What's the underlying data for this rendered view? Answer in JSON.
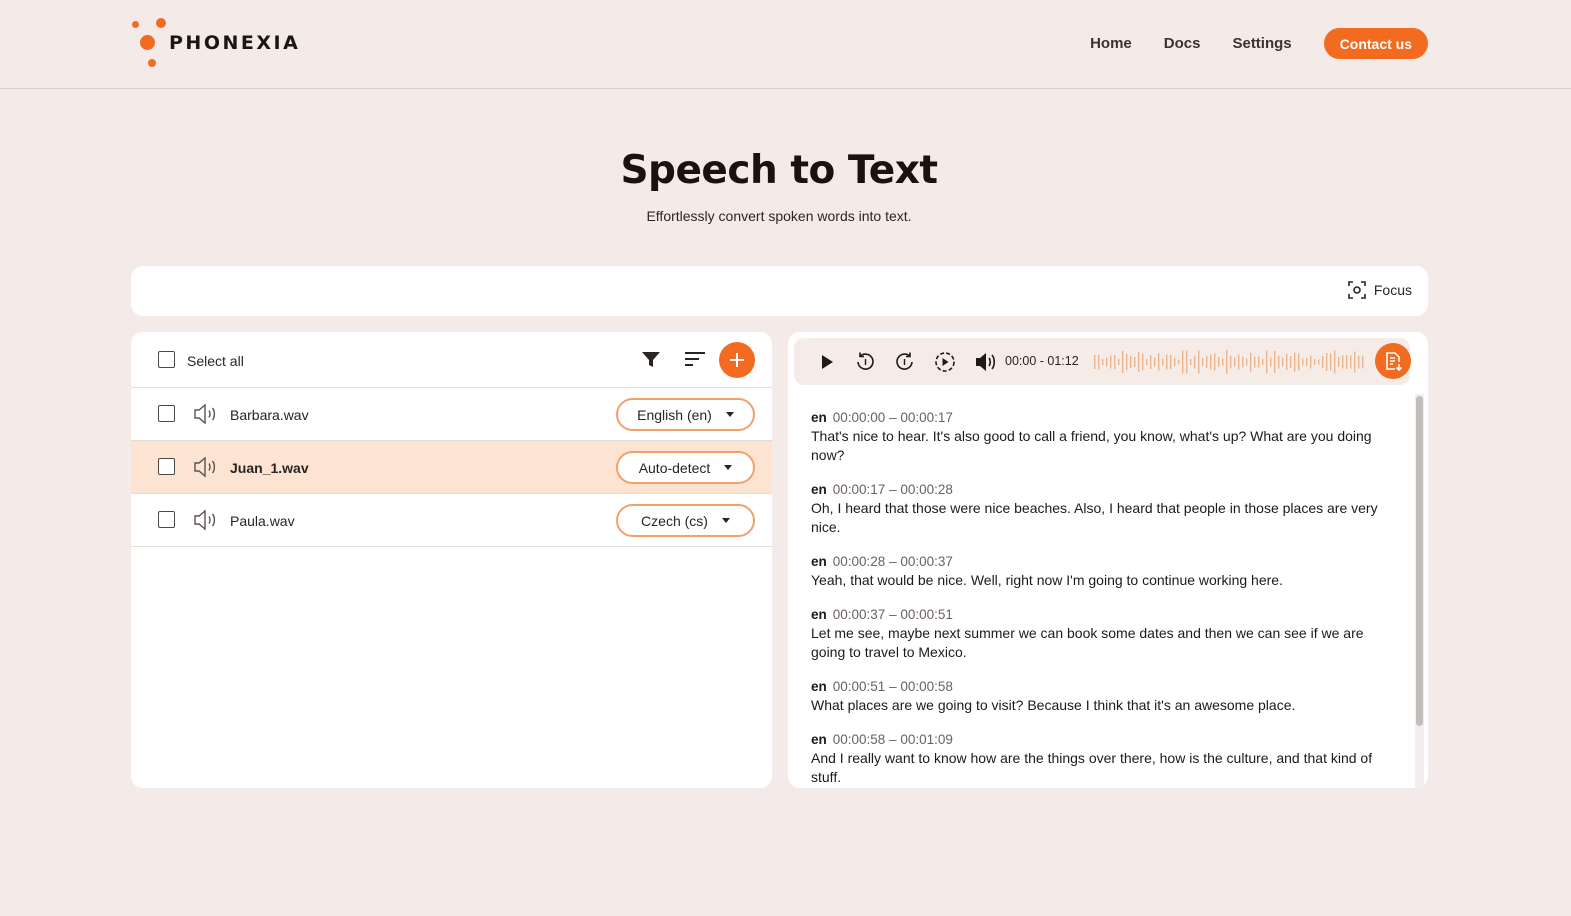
{
  "brand": {
    "name": "PHONEXIA",
    "accent": "#f26b21"
  },
  "nav": {
    "links": [
      {
        "label": "Home"
      },
      {
        "label": "Docs"
      },
      {
        "label": "Settings"
      }
    ],
    "contact_label": "Contact us"
  },
  "hero": {
    "title": "Speech to Text",
    "subtitle": "Effortlessly convert spoken words into text."
  },
  "toolbar": {
    "focus_label": "Focus",
    "focus_icon": "focus-icon"
  },
  "files": {
    "select_all_label": "Select all",
    "tools": [
      "filter-icon",
      "sort-icon",
      "plus-icon"
    ],
    "items": [
      {
        "name": "Barbara.wav",
        "language": "English (en)",
        "active": false
      },
      {
        "name": "Juan_1.wav",
        "language": "Auto-detect",
        "active": true
      },
      {
        "name": "Paula.wav",
        "language": "Czech (cs)",
        "active": false
      }
    ]
  },
  "player": {
    "time_range": "00:00 - 01:12",
    "icons": [
      "play-icon",
      "rewind-icon",
      "forward-icon",
      "playback-speed-icon",
      "volume-icon",
      "export-transcript-icon"
    ]
  },
  "transcript": {
    "segments": [
      {
        "lang": "en",
        "time": "00:00:00 – 00:00:17",
        "text": "That's nice to hear. It's also good to call a friend, you know, what's up? What are you doing now?"
      },
      {
        "lang": "en",
        "time": "00:00:17 – 00:00:28",
        "text": "Oh, I heard that those were nice beaches. Also, I heard that people in those places are very nice."
      },
      {
        "lang": "en",
        "time": "00:00:28 – 00:00:37",
        "text": "Yeah, that would be nice. Well, right now I'm going to continue working here."
      },
      {
        "lang": "en",
        "time": "00:00:37 – 00:00:51",
        "text": "Let me see, maybe next summer we can book some dates and then we can see if we are going to travel to Mexico."
      },
      {
        "lang": "en",
        "time": "00:00:51 – 00:00:58",
        "text": "What places are we going to visit? Because I think that it's an awesome place."
      },
      {
        "lang": "en",
        "time": "00:00:58 – 00:01:09",
        "text": "And I really want to know how are the things over there, how is the culture, and that kind of stuff."
      }
    ]
  }
}
